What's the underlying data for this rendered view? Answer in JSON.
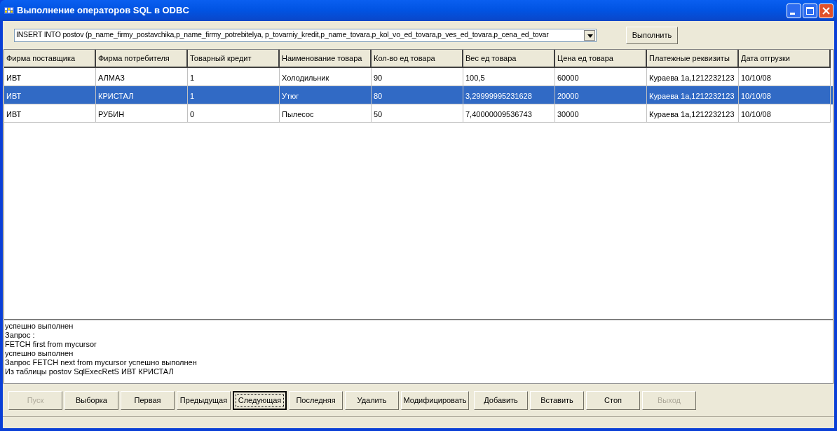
{
  "window": {
    "title": "Выполнение операторов SQL в ODBC"
  },
  "query": {
    "value": "INSERT INTO postov (p_name_firmy_postavchika,p_name_firmy_potrebitelya, p_tovarniy_kredit,p_name_tovara,p_kol_vo_ed_tovara,p_ves_ed_tovara,p_cena_ed_tovar"
  },
  "execute_button": "Выполнить",
  "table": {
    "columns": [
      "Фирма поставщика",
      "Фирма потребителя",
      "Товарный кредит",
      "Наименование товара",
      "Кол-во ед товара",
      "Вес ед товара",
      "Цена ед товара",
      "Платежные реквизиты",
      "Дата отгрузки"
    ],
    "rows": [
      {
        "selected": false,
        "cells": [
          "ИВТ",
          "АЛМАЗ",
          "1",
          "Холодильник",
          "90",
          "100,5",
          "60000",
          "Кураева 1а,1212232123",
          "10/10/08"
        ]
      },
      {
        "selected": true,
        "cells": [
          "ИВТ",
          "КРИСТАЛ",
          "1",
          "Утюг",
          "80",
          "3,29999995231628",
          "20000",
          "Кураева 1а,1212232123",
          "10/10/08"
        ]
      },
      {
        "selected": false,
        "cells": [
          "ИВТ",
          "РУБИН",
          "0",
          "Пылесос",
          "50",
          "7,40000009536743",
          "30000",
          "Кураева 1а,1212232123",
          "10/10/08"
        ]
      }
    ]
  },
  "log": [
    "успешно выполнен",
    "Запрос :",
    "FETCH first from mycursor",
    "успешно выполнен",
    "Запрос FETCH next from mycursor успешно выполнен",
    "Из таблицы postov SqlExecRetS ИВТ КРИСТАЛ"
  ],
  "buttons": [
    {
      "label": "Пуск",
      "disabled": true,
      "focused": false
    },
    {
      "label": "Выборка",
      "disabled": false,
      "focused": false
    },
    {
      "label": "Первая",
      "disabled": false,
      "focused": false
    },
    {
      "label": "Предыдущая",
      "disabled": false,
      "focused": false
    },
    {
      "label": "Следующая",
      "disabled": false,
      "focused": true
    },
    {
      "label": "Последняя",
      "disabled": false,
      "focused": false
    },
    {
      "label": "Удалить",
      "disabled": false,
      "focused": false
    },
    {
      "label": "Модифицировать",
      "disabled": false,
      "focused": false
    },
    {
      "label": "Добавить",
      "disabled": false,
      "focused": false
    },
    {
      "label": "Вставить",
      "disabled": false,
      "focused": false
    },
    {
      "label": "Стоп",
      "disabled": false,
      "focused": false
    },
    {
      "label": "Выход",
      "disabled": true,
      "focused": false
    }
  ]
}
